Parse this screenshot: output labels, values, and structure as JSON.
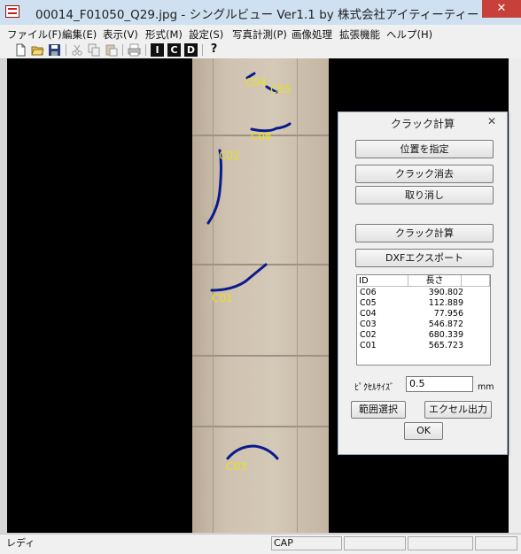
{
  "window": {
    "title": "00014_F01050_Q29.jpg  -  シングルビュー Ver1.1   by 株式会社アイティーティー",
    "close_label": "✕"
  },
  "menu": [
    {
      "label": "ファイル(F)"
    },
    {
      "label": "編集(E)"
    },
    {
      "label": "表示(V)"
    },
    {
      "label": "形式(M)"
    },
    {
      "label": "設定(S)"
    },
    {
      "label": "写真計測(P)"
    },
    {
      "label": "画像処理"
    },
    {
      "label": "拡張機能"
    },
    {
      "label": "ヘルプ(H)"
    }
  ],
  "toolbar": {
    "letters": [
      "I",
      "C",
      "D"
    ],
    "help": "?"
  },
  "cracks": [
    {
      "label": "C04"
    },
    {
      "label": "C05"
    },
    {
      "label": "C06"
    },
    {
      "label": "C02"
    },
    {
      "label": "C01"
    },
    {
      "label": "C03"
    }
  ],
  "dialog": {
    "title": "クラック計算",
    "close": "✕",
    "buttons": {
      "set_position": "位置を指定",
      "erase_crack": "クラック消去",
      "cancel": "取り消し",
      "calc_crack": "クラック計算",
      "dxf_export": "DXFエクスポート",
      "range_select": "範囲選択",
      "excel_output": "エクセル出力",
      "ok": "OK"
    },
    "list": {
      "headers": [
        "ID",
        "長さ"
      ],
      "rows": [
        {
          "id": "C06",
          "length": "390.802"
        },
        {
          "id": "C05",
          "length": "112.889"
        },
        {
          "id": "C04",
          "length": "77.956"
        },
        {
          "id": "C03",
          "length": "546.872"
        },
        {
          "id": "C02",
          "length": "680.339"
        },
        {
          "id": "C01",
          "length": "565.723"
        }
      ]
    },
    "pixel_size": {
      "label": "ﾋﾟｸｾﾙｻｲｽﾞ",
      "value": "0.5",
      "unit": "mm"
    }
  },
  "status": {
    "ready": "レディ",
    "cap": "CAP"
  },
  "colors": {
    "crack_line": "#0a1a8c",
    "crack_label": "#e8e020"
  }
}
